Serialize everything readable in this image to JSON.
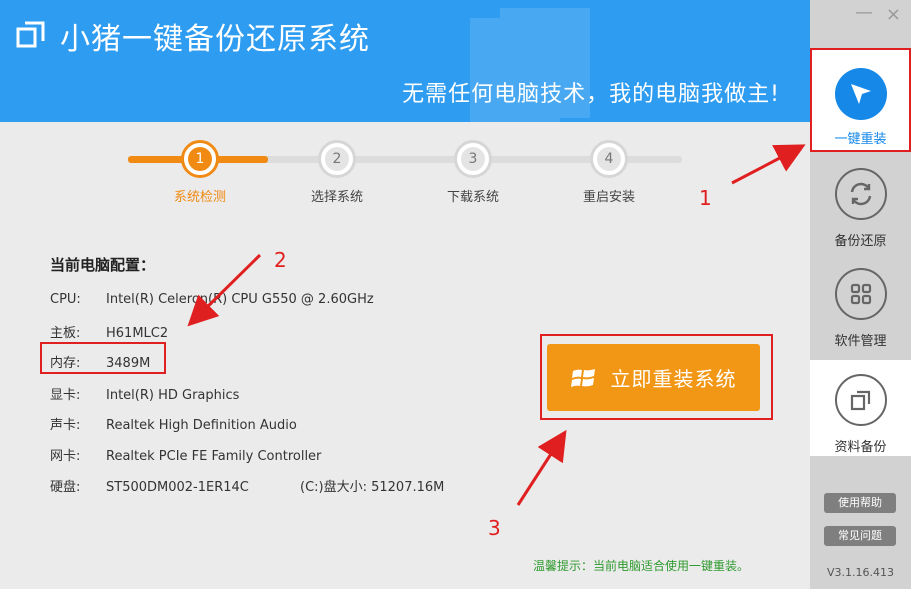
{
  "header": {
    "title": "小猪一键备份还原系统",
    "slogan": "无需任何电脑技术，我的电脑我做主!"
  },
  "window": {
    "minimize": "—",
    "close": "×"
  },
  "sidebar": {
    "items": [
      {
        "label": "一键重装",
        "icon": "cursor-arrow-icon"
      },
      {
        "label": "备份还原",
        "icon": "refresh-icon"
      },
      {
        "label": "软件管理",
        "icon": "grid-icon"
      },
      {
        "label": "资料备份",
        "icon": "copy-icon"
      }
    ],
    "help": "使用帮助",
    "faq": "常见问题",
    "version": "V3.1.16.413"
  },
  "steps": [
    {
      "num": "1",
      "label": "系统检测"
    },
    {
      "num": "2",
      "label": "选择系统"
    },
    {
      "num": "3",
      "label": "下载系统"
    },
    {
      "num": "4",
      "label": "重启安装"
    }
  ],
  "config": {
    "title": "当前电脑配置：",
    "rows": [
      {
        "key": "CPU:",
        "value": "Intel(R) Celeron(R) CPU G550 @ 2.60GHz"
      },
      {
        "key": "主板:",
        "value": "H61MLC2"
      },
      {
        "key": "内存:",
        "value": "3489M"
      },
      {
        "key": "显卡:",
        "value": "Intel(R) HD Graphics"
      },
      {
        "key": "声卡:",
        "value": "Realtek High Definition Audio"
      },
      {
        "key": "网卡:",
        "value": "Realtek PCIe FE Family Controller"
      },
      {
        "key": "硬盘:",
        "value": "ST500DM002-1ER14C"
      }
    ],
    "disk_extra": "(C:)盘大小: 51207.16M"
  },
  "install_button": "立即重装系统",
  "tip": "温馨提示：当前电脑适合使用一键重装。",
  "annotations": [
    "1",
    "2",
    "3"
  ],
  "colors": {
    "header": "#2e9cf0",
    "accent": "#f08a12",
    "highlight": "#e02020",
    "tip": "#2f9a2f"
  }
}
